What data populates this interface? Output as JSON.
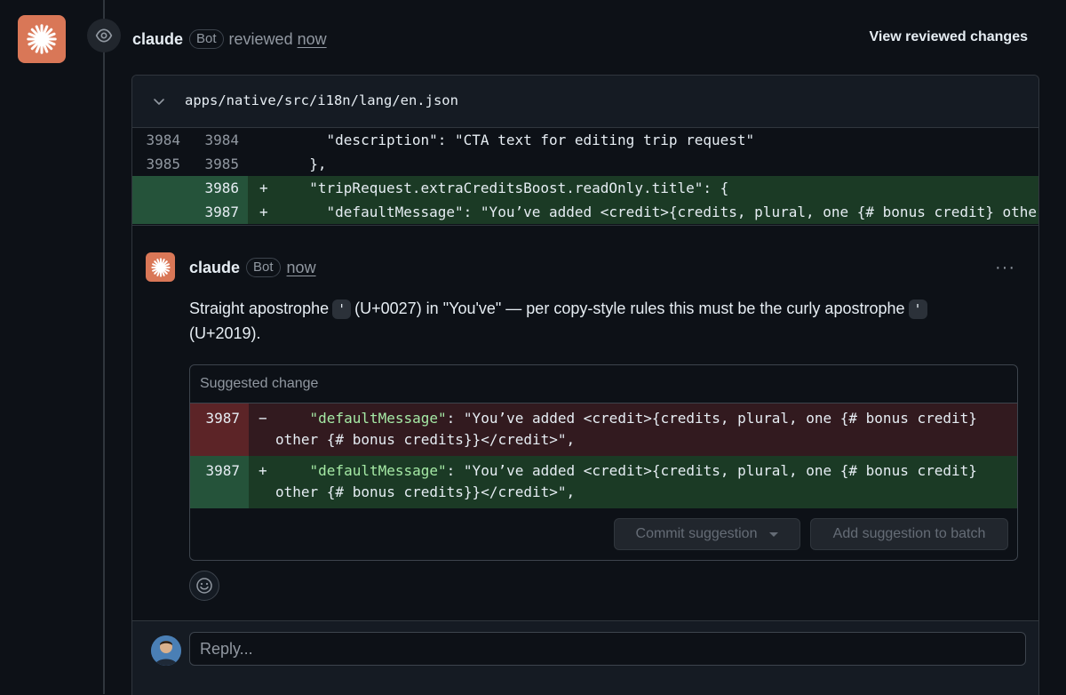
{
  "review": {
    "author": "claude",
    "badge": "Bot",
    "action": "reviewed",
    "time": "now",
    "view_changes": "View reviewed changes"
  },
  "file": {
    "path": "apps/native/src/i18n/lang/en.json",
    "lines": [
      {
        "old": "3984",
        "new": "3984",
        "sign": "",
        "code": "    \"description\": \"CTA text for editing trip request\"",
        "type": "context"
      },
      {
        "old": "3985",
        "new": "3985",
        "sign": "",
        "code": "  },",
        "type": "context"
      },
      {
        "old": "",
        "new": "3986",
        "sign": "+",
        "code": "  \"tripRequest.extraCreditsBoost.readOnly.title\": {",
        "type": "add"
      },
      {
        "old": "",
        "new": "3987",
        "sign": "+",
        "code": "    \"defaultMessage\": \"You’ve added <credit>{credits, plural, one {# bonus credit} other",
        "type": "add"
      }
    ]
  },
  "comment": {
    "author": "claude",
    "badge": "Bot",
    "time": "now",
    "more": "···",
    "body_part1": "Straight apostrophe",
    "tick1": "'",
    "body_part2": "(U+0027) in \"You've\" — per copy-style rules this must be the curly apostrophe",
    "tick2": "'",
    "body_part3": "(U+2019).",
    "suggestion_title": "Suggested change",
    "del": {
      "line": "3987",
      "sign": "−",
      "key": "\"defaultMessage\"",
      "rest": ": \"You’ve added <credit>{credits, plural, one {# bonus credit}",
      "cont": "other {# bonus credits}}</credit>\","
    },
    "ins": {
      "line": "3987",
      "sign": "+",
      "key": "\"defaultMessage\"",
      "rest": ": \"You’ve added <credit>{credits, plural, one {# bonus credit}",
      "cont": "other {# bonus credits}}</credit>\","
    },
    "commit_button": "Commit suggestion",
    "batch_button": "Add suggestion to batch"
  },
  "reply": {
    "placeholder": "Reply..."
  }
}
